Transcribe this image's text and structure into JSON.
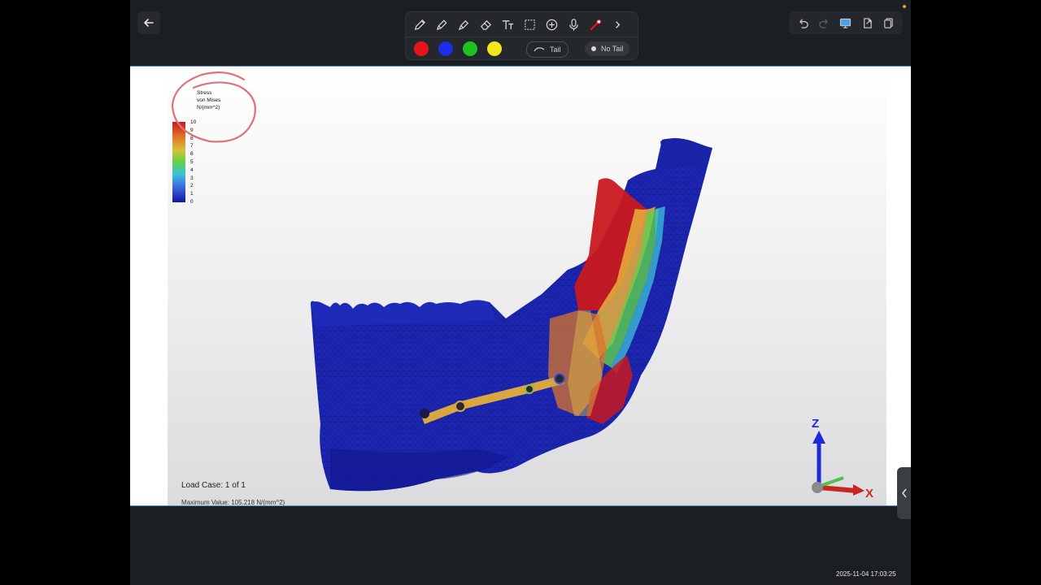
{
  "toolbar": {
    "tools": [
      "pencil-icon",
      "pen-icon",
      "highlighter-icon",
      "eraser-icon",
      "text-icon",
      "lasso-select-icon",
      "add-icon",
      "microphone-icon",
      "laser-pointer-icon",
      "chevron-right-icon"
    ],
    "colors": [
      "#e8141a",
      "#1c2fe6",
      "#1ec21e",
      "#f1e51b"
    ],
    "tail_label": "Tail",
    "no_tail_label": "No Tail"
  },
  "right_tools": [
    "undo-icon",
    "redo-icon",
    "present-icon",
    "export-icon",
    "copy-icon"
  ],
  "legend": {
    "title_line1": "Stress",
    "title_line2": "von Mises",
    "title_line3": "N/(mm^2)",
    "ticks": [
      "10",
      "9",
      "8",
      "7",
      "6",
      "5",
      "4",
      "3",
      "2",
      "1",
      "0"
    ]
  },
  "load_case": "Load Case:  1 of 1",
  "max_value": "Maximum Value: 105.218 N/(mm^2)",
  "axes": {
    "z": "Z",
    "x": "X"
  },
  "timestamp": "2025-11-04 17:03:25"
}
